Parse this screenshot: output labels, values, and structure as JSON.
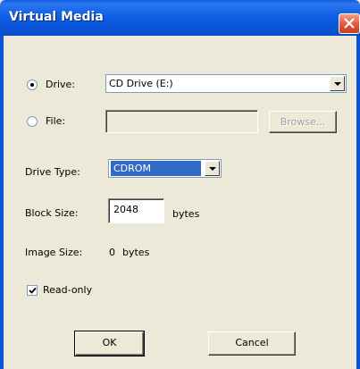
{
  "window": {
    "title": "Virtual Media"
  },
  "source": {
    "drive_label": "Drive:",
    "drive_selected": true,
    "drive_value": "CD Drive (E:)",
    "file_label": "File:",
    "file_selected": false,
    "file_value": "",
    "browse_label": "Browse..."
  },
  "drive_type": {
    "label": "Drive Type:",
    "value": "CDROM"
  },
  "block_size": {
    "label": "Block Size:",
    "value": "2048",
    "unit": "bytes"
  },
  "image_size": {
    "label": "Image Size:",
    "value": "0",
    "unit": "bytes"
  },
  "read_only": {
    "label": "Read-only",
    "checked": true
  },
  "buttons": {
    "ok": "OK",
    "cancel": "Cancel"
  },
  "colors": {
    "titlebar": "#0A52D8",
    "dialog_bg": "#ECE9D8",
    "selection": "#316AC5",
    "close": "#E0573A"
  }
}
